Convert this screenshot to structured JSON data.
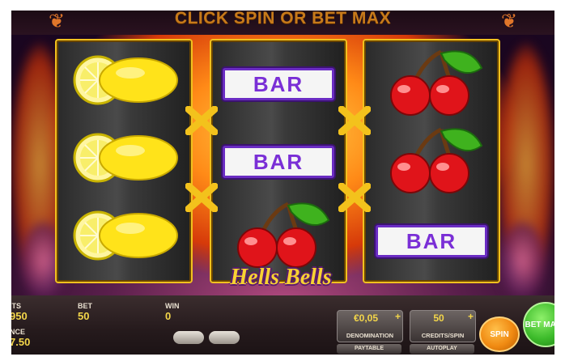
{
  "title": "CLICK SPIN OR BET MAX",
  "logo": "Hells Bells",
  "reels": [
    [
      "lemon",
      "lemon",
      "lemon"
    ],
    [
      "bar",
      "bar",
      "cherries"
    ],
    [
      "cherries",
      "cherries",
      "bar"
    ]
  ],
  "bar_label": "BAR",
  "status": {
    "credits_label": "ITS",
    "credits_value": "950",
    "bet_label": "BET",
    "bet_value": "50",
    "win_label": "WIN",
    "win_value": "0",
    "balance_label": "NCE",
    "balance_value": "7.50"
  },
  "controls": {
    "denomination_value": "€0,05",
    "denomination_caption": "DENOMINATION",
    "credits_spin_value": "50",
    "credits_spin_caption": "CREDITS/SPIN",
    "paytable_label": "PAYTABLE",
    "autoplay_label": "AUTOPLAY",
    "spin_label": "SPIN",
    "bet_max_label": "BET MAX"
  },
  "colors": {
    "reel_border": "#f2c11e",
    "bar_purple": "#7a2fd6",
    "spin_orange": "#f08a12",
    "bet_max_green": "#3dbb2b",
    "value_yellow": "#f3d64a"
  }
}
